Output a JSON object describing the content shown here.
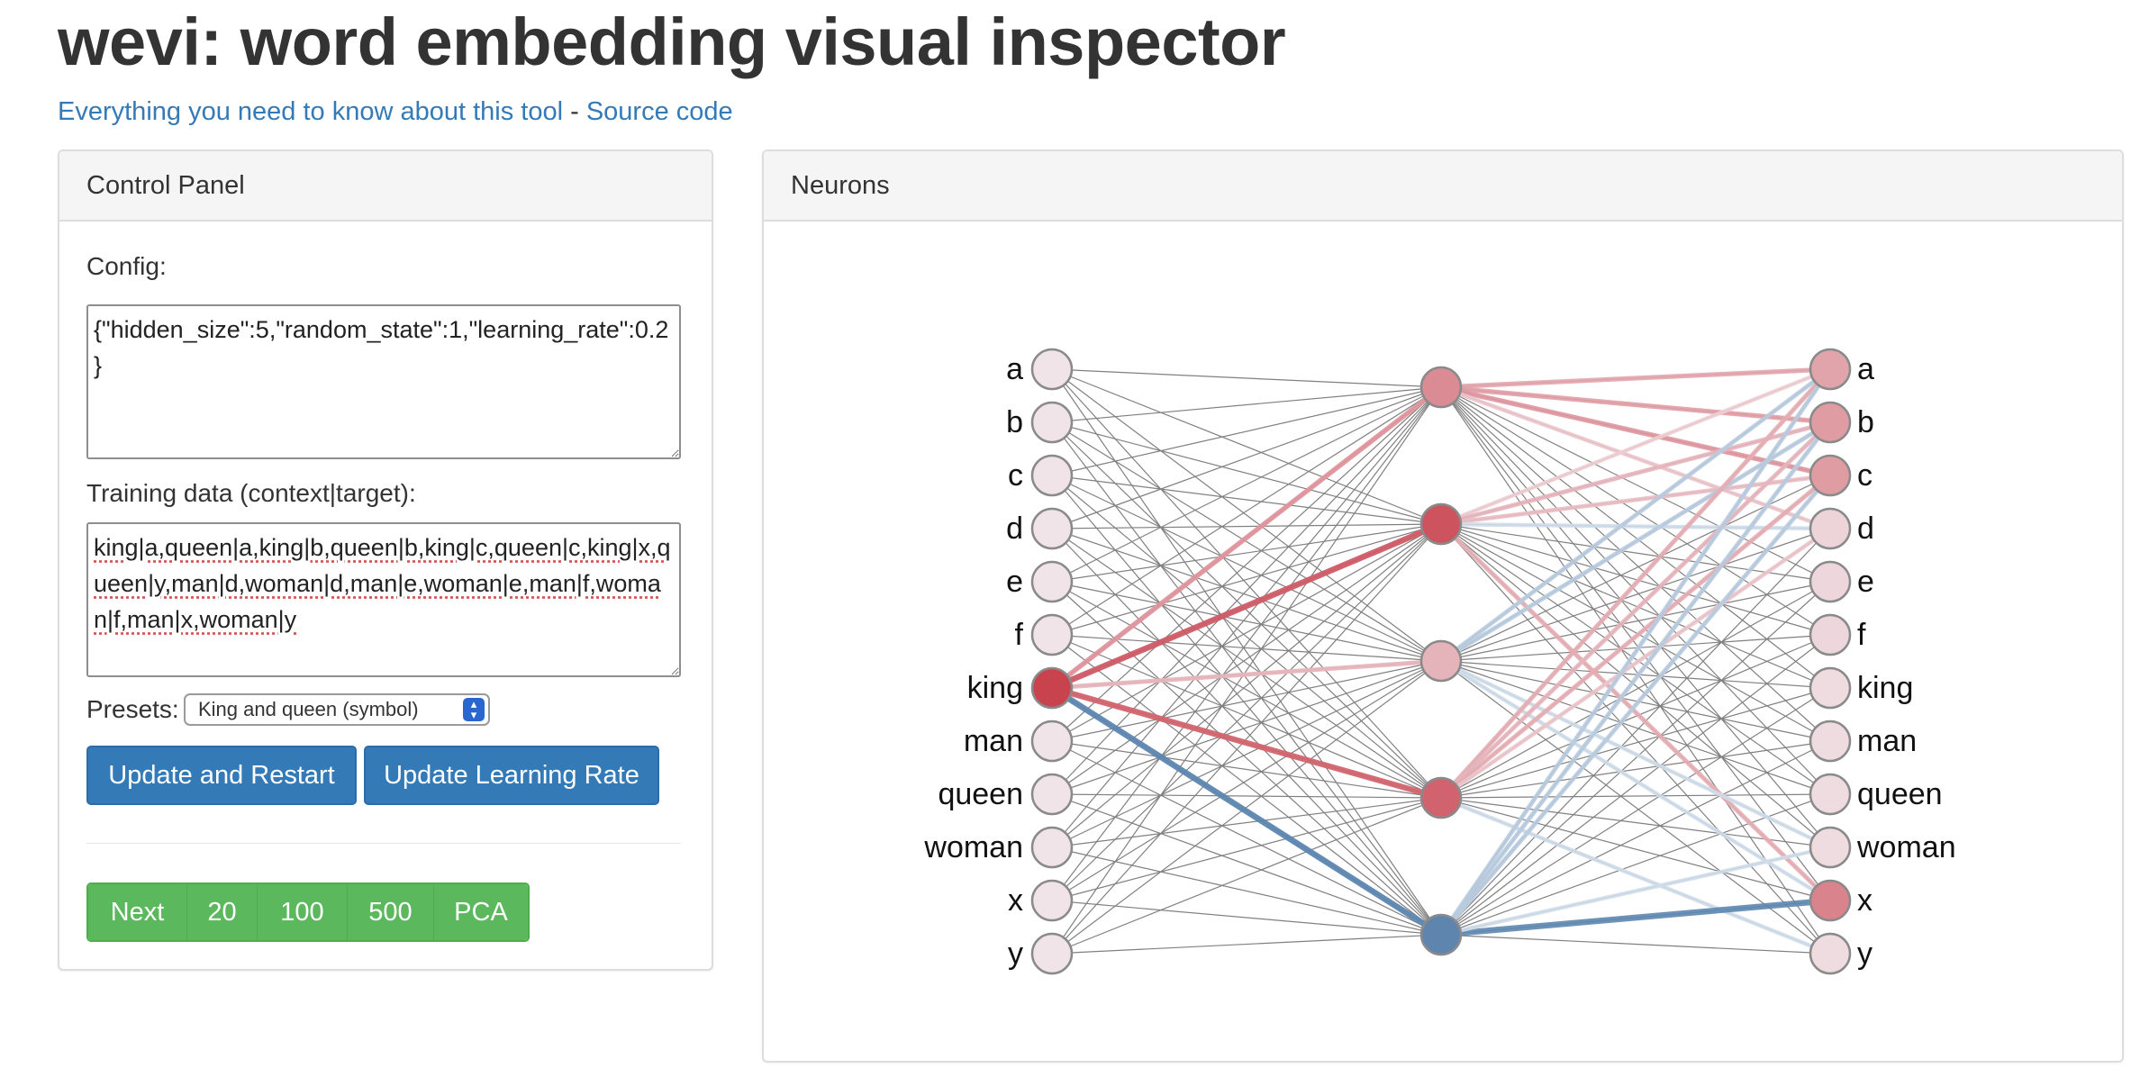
{
  "page": {
    "title": "wevi: word embedding visual inspector",
    "link_about": "Everything you need to know about this tool",
    "link_separator": " - ",
    "link_source": "Source code"
  },
  "control_panel": {
    "heading": "Control Panel",
    "config_label": "Config:",
    "config_value": "{\"hidden_size\":5,\"random_state\":1,\"learning_rate\":0.2}",
    "training_label": "Training data (context|target):",
    "training_value": "king|a,queen|a,king|b,queen|b,king|c,queen|c,king|x,queen|y,man|d,woman|d,man|e,woman|e,man|f,woman|f,man|x,woman|y",
    "presets_label": "Presets:",
    "presets_selected": "King and queen (symbol)",
    "update_restart": "Update and Restart",
    "update_lr": "Update Learning Rate",
    "step_buttons": [
      "Next",
      "20",
      "100",
      "500",
      "PCA"
    ]
  },
  "neurons": {
    "heading": "Neurons",
    "input_words": [
      "a",
      "b",
      "c",
      "d",
      "e",
      "f",
      "king",
      "man",
      "queen",
      "woman",
      "x",
      "y"
    ],
    "output_words": [
      "a",
      "b",
      "c",
      "d",
      "e",
      "f",
      "king",
      "man",
      "queen",
      "woman",
      "x",
      "y"
    ],
    "hidden_count": 5,
    "input_activation": [
      0,
      0,
      0,
      0,
      0,
      0,
      1,
      0,
      0,
      0,
      0,
      0
    ],
    "hidden_activation": [
      0.55,
      0.9,
      0.3,
      0.8,
      -0.9
    ],
    "output_activation": [
      0.4,
      0.45,
      0.45,
      0.1,
      0.08,
      0.08,
      0.05,
      0.05,
      0.05,
      0.05,
      0.6,
      0.05
    ],
    "input_hidden_weights": {
      "king": [
        0.5,
        0.85,
        0.3,
        0.8,
        -0.9
      ]
    },
    "hidden_output_weights": [
      {
        "h": 0,
        "o": 0,
        "w": 0.4
      },
      {
        "h": 0,
        "o": 1,
        "w": 0.45
      },
      {
        "h": 0,
        "o": 2,
        "w": 0.5
      },
      {
        "h": 0,
        "o": 3,
        "w": 0.2
      },
      {
        "h": 1,
        "o": 0,
        "w": 0.15
      },
      {
        "h": 1,
        "o": 1,
        "w": 0.3
      },
      {
        "h": 1,
        "o": 2,
        "w": 0.25
      },
      {
        "h": 1,
        "o": 10,
        "w": 0.35
      },
      {
        "h": 1,
        "o": 3,
        "w": -0.15
      },
      {
        "h": 2,
        "o": 0,
        "w": -0.3
      },
      {
        "h": 2,
        "o": 1,
        "w": -0.3
      },
      {
        "h": 2,
        "o": 9,
        "w": -0.15
      },
      {
        "h": 2,
        "o": 10,
        "w": -0.15
      },
      {
        "h": 3,
        "o": 0,
        "w": 0.35
      },
      {
        "h": 3,
        "o": 1,
        "w": 0.3
      },
      {
        "h": 3,
        "o": 2,
        "w": 0.35
      },
      {
        "h": 3,
        "o": 3,
        "w": 0.2
      },
      {
        "h": 3,
        "o": 11,
        "w": -0.15
      },
      {
        "h": 4,
        "o": 0,
        "w": -0.3
      },
      {
        "h": 4,
        "o": 1,
        "w": -0.3
      },
      {
        "h": 4,
        "o": 2,
        "w": -0.3
      },
      {
        "h": 4,
        "o": 10,
        "w": -0.9
      },
      {
        "h": 4,
        "o": 9,
        "w": -0.15
      }
    ],
    "colors": {
      "positive": "#c9434f",
      "negative": "#4e7aa8",
      "neutral_node": "#f1e4e8",
      "node_stroke": "#8a8a8a",
      "thin_edge": "#808080"
    }
  }
}
